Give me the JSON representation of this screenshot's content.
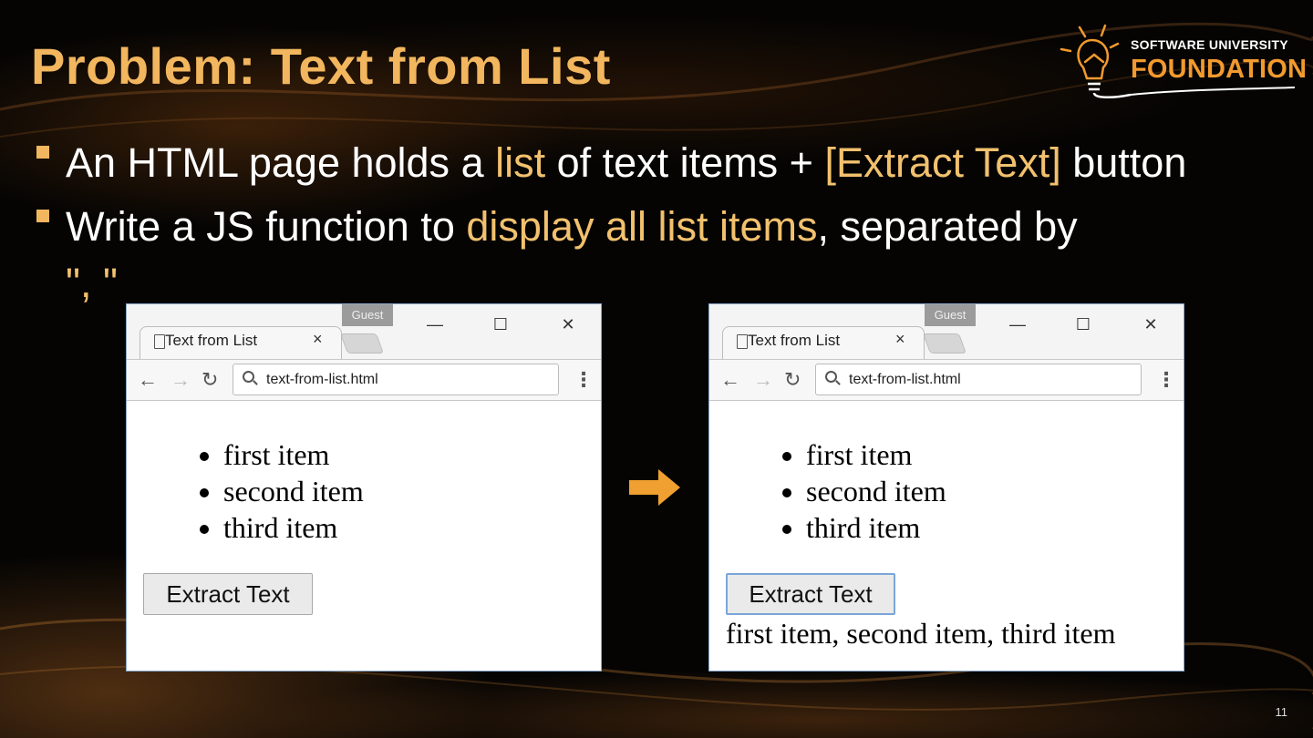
{
  "slide": {
    "title": "Problem: Text from List",
    "number": "11",
    "accent_color": "#f2b65e"
  },
  "logo": {
    "line1": "SOFTWARE UNIVERSITY",
    "line2": "FOUNDATION",
    "icon": "lightbulb-icon"
  },
  "bullets": [
    {
      "p1": "An HTML page holds a ",
      "h1": "list",
      "p2": " of text items + ",
      "h2": "[Extract Text]",
      "p3": " button"
    },
    {
      "p1": "Write a JS function to ",
      "h1": "display all list items",
      "p2": ", separated by",
      "p3": "\", \""
    }
  ],
  "browser_before": {
    "guest_label": "Guest",
    "tab_title": "Text from List",
    "tab_close": "×",
    "url": "text-from-list.html",
    "items": [
      "first item",
      "second item",
      "third item"
    ],
    "button_label": "Extract Text",
    "result": ""
  },
  "browser_after": {
    "guest_label": "Guest",
    "tab_title": "Text from List",
    "tab_close": "×",
    "url": "text-from-list.html",
    "items": [
      "first item",
      "second item",
      "third item"
    ],
    "button_label": "Extract Text",
    "result": "first item, second item, third item"
  },
  "arrow": {
    "icon": "right-arrow-icon",
    "color": "#f0a030"
  }
}
